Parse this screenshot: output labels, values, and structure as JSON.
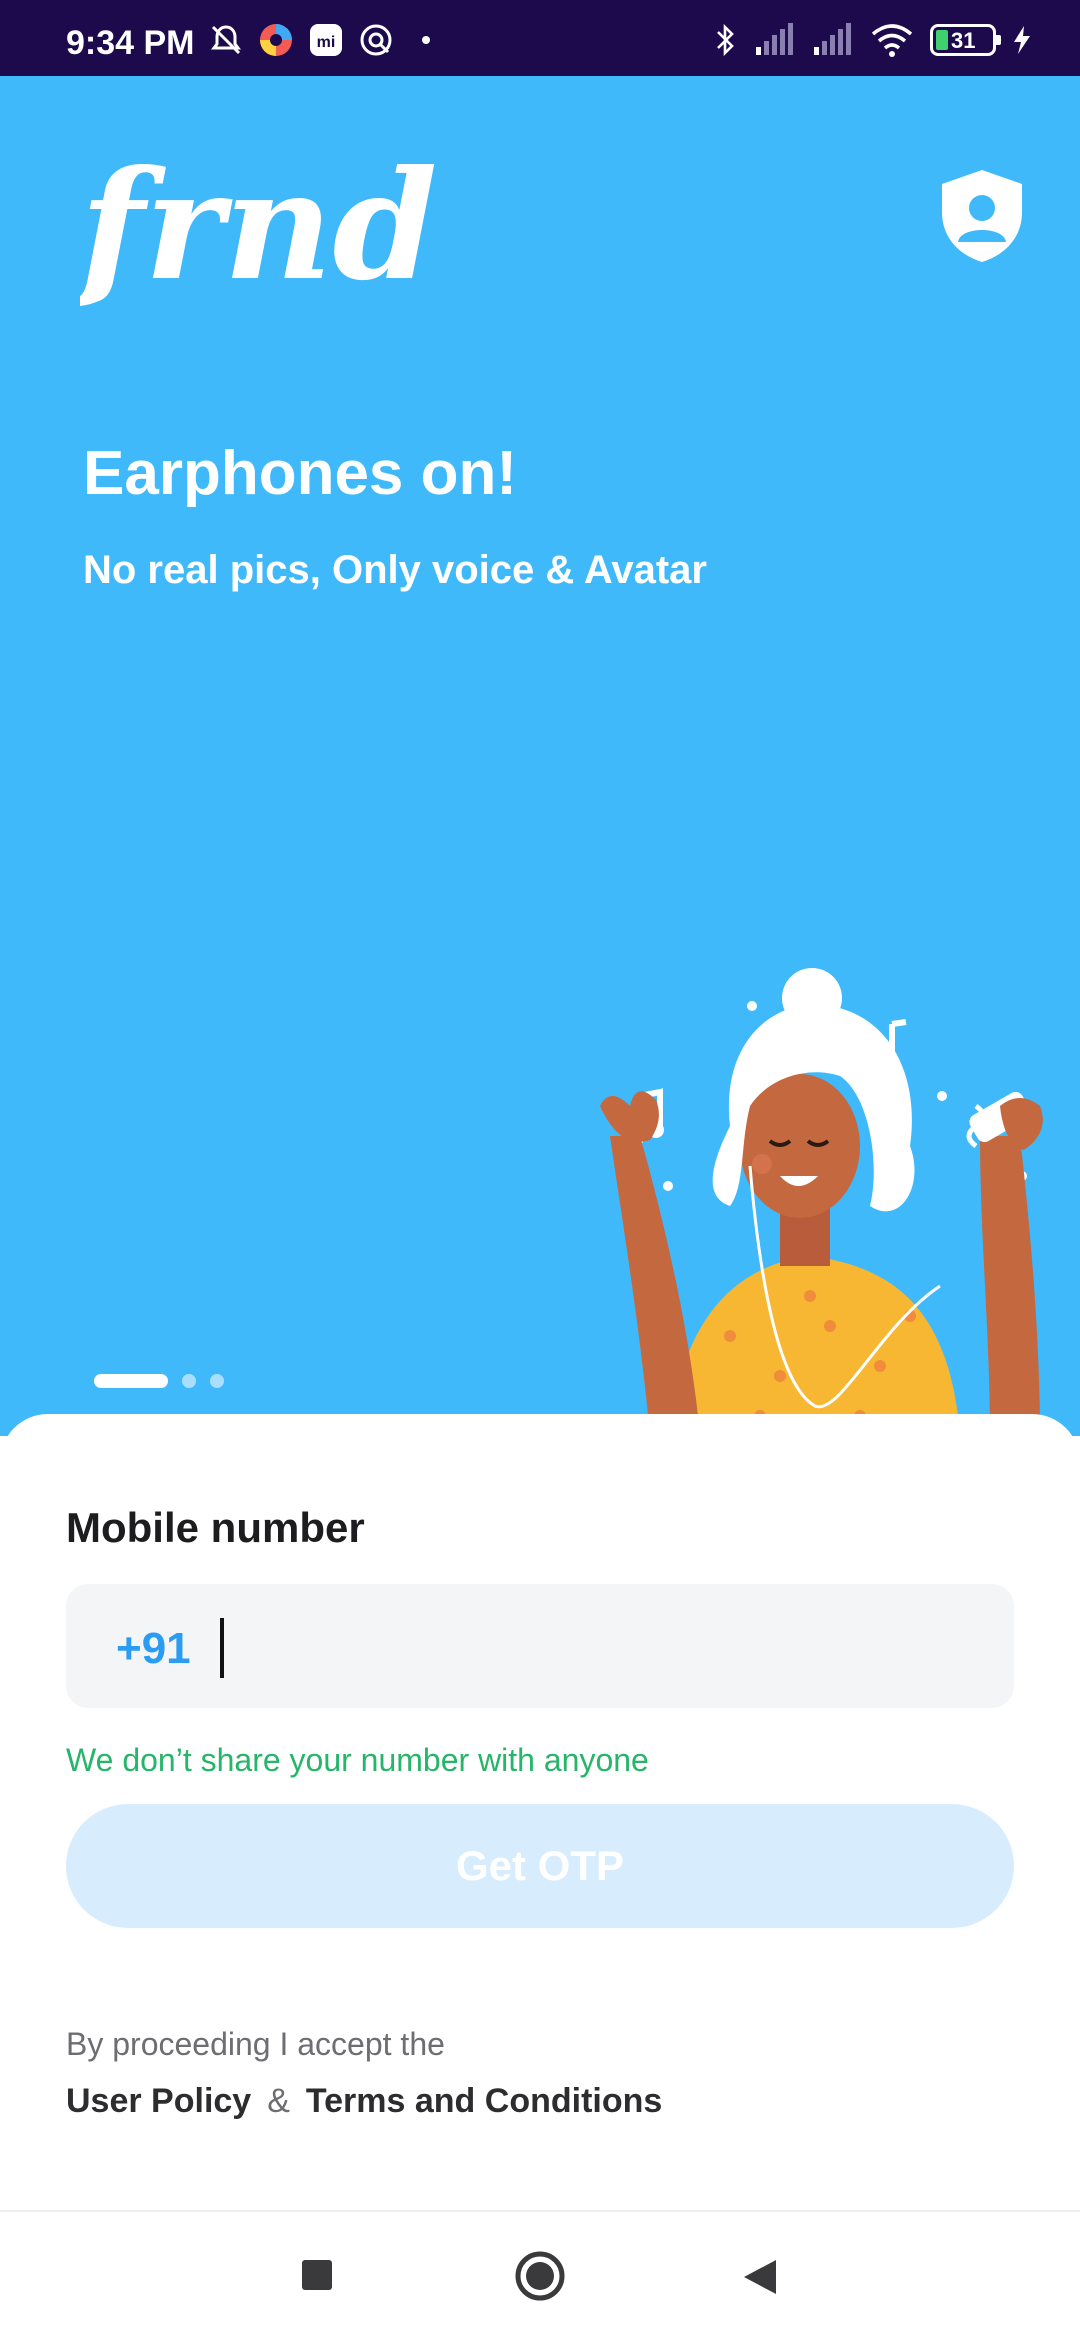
{
  "status_bar": {
    "time": "9:34 PM",
    "battery": "31",
    "left_icons": [
      "mute-icon",
      "photos-app-icon",
      "mi-icon",
      "sync-icon",
      "dot-icon"
    ],
    "right_icons": [
      "bluetooth-icon",
      "signal-icon",
      "signal-icon",
      "wifi-icon",
      "battery-icon",
      "charging-icon"
    ]
  },
  "hero": {
    "logo_text": "frnd",
    "headline": "Earphones on!",
    "subline": "No real pics, Only voice & Avatar",
    "carousel": {
      "total": 3,
      "active": 1
    },
    "illustration": "woman-listening-music-illustration"
  },
  "form": {
    "label": "Mobile number",
    "country_code": "+91",
    "phone_value": "",
    "privacy_note": "We don’t share your number with anyone",
    "otp_button": "Get OTP"
  },
  "legal": {
    "prefix": "By proceeding I accept the",
    "user_policy": "User Policy",
    "ampersand": "&",
    "terms": "Terms and Conditions"
  },
  "colors": {
    "hero_bg": "#40b9fb",
    "status_bg": "#1d0a4d",
    "accent_blue": "#2a9cf2",
    "privacy_green": "#27b56a",
    "button_disabled": "#d7ecfd"
  },
  "nav": [
    "recents-square-icon",
    "home-circle-icon",
    "back-triangle-icon"
  ]
}
